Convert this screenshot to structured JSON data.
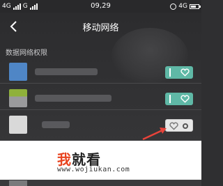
{
  "status_bar": {
    "network_left": "4G",
    "carrier_mark": "G",
    "time": "09,29",
    "network_right": "4G"
  },
  "header": {
    "title": "移动网络"
  },
  "section": {
    "label": "数据网络权限"
  },
  "apps": [
    {
      "icon_color": "#4f86c6",
      "toggle": "on"
    },
    {
      "icon_color": "#8fb13a",
      "toggle": "on"
    },
    {
      "icon_color": "#d9d9d9",
      "toggle": "off"
    }
  ],
  "watermark": {
    "char1": "我",
    "rest": "就看",
    "url": "www.wojiukan.com"
  },
  "colors": {
    "toggle_on": "#5fb8a6",
    "arrow": "#e8433a",
    "brand_red": "#e8431f"
  }
}
